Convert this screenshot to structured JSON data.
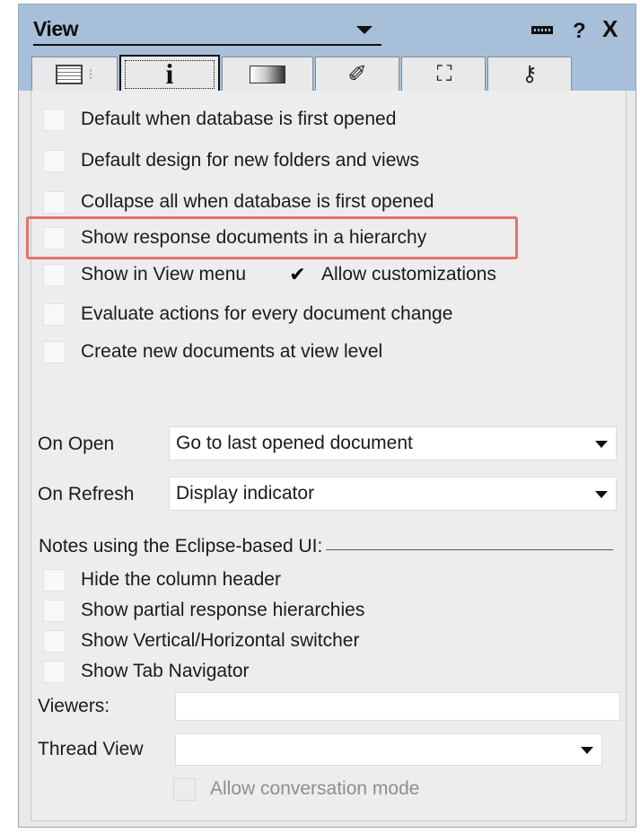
{
  "window": {
    "title": "View",
    "help_label": "?",
    "close_label": "X"
  },
  "tabs": [
    {
      "name": "basics",
      "icon": "table-grid-icon"
    },
    {
      "name": "info",
      "icon": "info-icon",
      "glyph": "i",
      "active": true
    },
    {
      "name": "style",
      "icon": "gradient-icon"
    },
    {
      "name": "font",
      "icon": "pen-icon",
      "glyph": "✐"
    },
    {
      "name": "advanced",
      "icon": "chart-icon",
      "glyph": "⛶"
    },
    {
      "name": "security",
      "icon": "key-icon",
      "glyph": "⚷"
    }
  ],
  "options": {
    "default_open": {
      "label": "Default when database is first opened",
      "checked": false
    },
    "default_design": {
      "label": "Default design for new folders and views",
      "checked": false
    },
    "collapse_all": {
      "label": "Collapse all when database is first opened",
      "checked": false
    },
    "show_hierarchy": {
      "label": "Show response documents in a hierarchy",
      "checked": false
    },
    "show_in_menu": {
      "label": "Show in View menu",
      "checked": false
    },
    "allow_customizations": {
      "label": "Allow customizations",
      "checked": true
    },
    "evaluate_actions": {
      "label": "Evaluate actions for every document change",
      "checked": false
    },
    "create_new_docs": {
      "label": "Create new documents at view level",
      "checked": false
    }
  },
  "on_open": {
    "label": "On Open",
    "value": "Go to last opened document"
  },
  "on_refresh": {
    "label": "On Refresh",
    "value": "Display indicator"
  },
  "eclipse": {
    "heading": "Notes using the Eclipse-based UI:",
    "hide_column_header": {
      "label": "Hide the column header",
      "checked": false
    },
    "show_partial": {
      "label": "Show partial response hierarchies",
      "checked": false
    },
    "show_switcher": {
      "label": "Show Vertical/Horizontal switcher",
      "checked": false
    },
    "show_tab_nav": {
      "label": "Show Tab Navigator",
      "checked": false
    }
  },
  "viewers": {
    "label": "Viewers:",
    "value": ""
  },
  "thread_view": {
    "label": "Thread View",
    "value": ""
  },
  "allow_conversation": {
    "label": "Allow conversation mode",
    "checked": false,
    "disabled": true
  },
  "colors": {
    "titlebar": "#a8bfd9",
    "panel": "#ededed",
    "highlight": "#e5726e"
  }
}
